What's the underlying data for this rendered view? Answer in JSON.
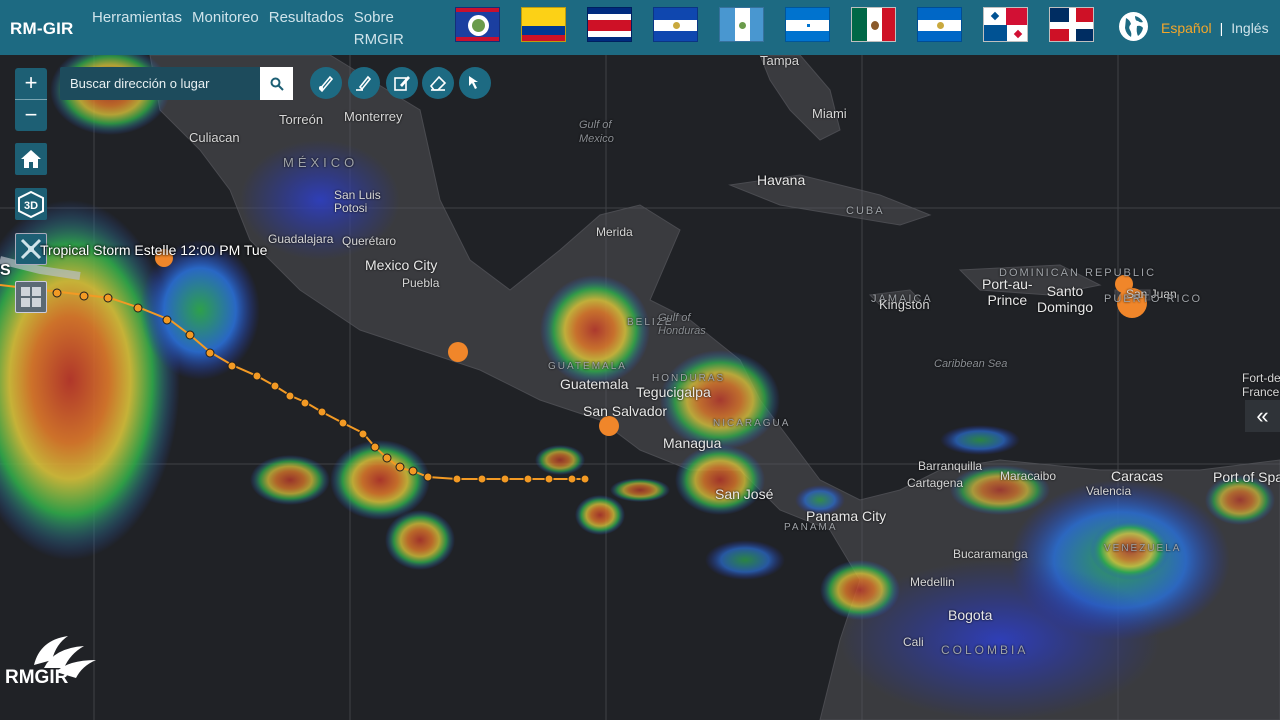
{
  "app": {
    "title": "RM-GIR",
    "nav": [
      "Herramientas",
      "Monitoreo",
      "Resultados",
      "Sobre RMGIR"
    ]
  },
  "languages": {
    "active": "Español",
    "separator": "|",
    "other": "Inglés"
  },
  "flags": [
    "belize",
    "colombia",
    "costa-rica",
    "el-salvador",
    "guatemala",
    "honduras",
    "mexico",
    "nicaragua",
    "panama",
    "dominican-republic"
  ],
  "search": {
    "placeholder": "Buscar dirección o lugar"
  },
  "zoom": {
    "in": "+",
    "out": "−"
  },
  "toolbar": {
    "three_d": "3D"
  },
  "storm": {
    "label": "Tropical Storm Estelle  12:00 PM Tue",
    "name": "S"
  },
  "collapse": {
    "label": "«"
  },
  "logo": {
    "text": "RMGIR"
  },
  "map_labels": {
    "tampa": "Tampa",
    "miami": "Miami",
    "gulf_mexico": "Gulf of\nMexico",
    "culiacan": "Culiacan",
    "torreon": "Torreón",
    "monterrey": "Monterrey",
    "mexico_country": "MÉXICO",
    "san_luis": "San Luis\nPotosi",
    "havana": "Havana",
    "cuba": "CUBA",
    "guadalajara": "Guadalajara",
    "queretaro": "Querétaro",
    "merida": "Merida",
    "mexico_city": "Mexico City",
    "puebla": "Puebla",
    "dominican": "DOMINICAN REPUBLIC",
    "port_au_prince": "Port-au-\nPrince",
    "santo_domingo": "Santo\nDomingo",
    "san_juan": "San Juan",
    "puerto_rico": "PUERTO RICO",
    "jamaica": "JAMAICA",
    "kingston": "Kingston",
    "belize": "BELIZE",
    "gulf_honduras": "Gulf of\nHonduras",
    "caribbean": "Caribbean Sea",
    "guatemala_country": "GUATEMALA",
    "guatemala": "Guatemala",
    "honduras": "HONDURAS",
    "tegucigalpa": "Tegucigalpa",
    "san_salvador": "San Salvador",
    "nicaragua": "NICARAGUA",
    "managua": "Managua",
    "fort_de_france": "Fort-de-\nFrance",
    "barranquilla": "Barranquilla",
    "cartagena": "Cartagena",
    "maracaibo": "Maracaibo",
    "caracas": "Caracas",
    "port_of_spain": "Port of Spa",
    "valencia": "Valencia",
    "san_jose": "San José",
    "panama": "PANAMA",
    "panama_city": "Panama City",
    "venezuela": "VENEZUELA",
    "bucaramanga": "Bucaramanga",
    "medellin": "Medellin",
    "bogota": "Bogota",
    "cali": "Cali",
    "colombia": "COLOMBIA"
  },
  "colors": {
    "topbar": "#1d6a82",
    "accent": "#f3a62a",
    "track": "#f39a24"
  }
}
